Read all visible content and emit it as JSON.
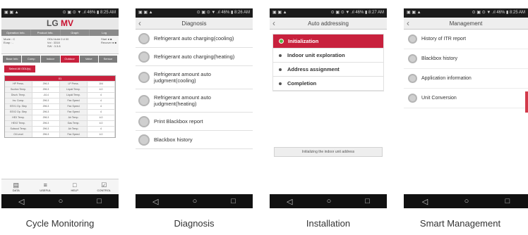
{
  "status_icons": "▣ ▣ ▲",
  "screens": {
    "cycle_monitoring": {
      "status_right": "⊙ ▣ ⊙ ▼ .ıl 46% ▮ 8:25 AM",
      "logo_prefix": "LG",
      "logo_suffix": "MV",
      "top_tabs": [
        "Operation Info.",
        "Product Info.",
        "Graph",
        "Log"
      ],
      "info_left": "Mode : C\nEvap : -",
      "info_mid": "ODU Addr 0 # 00\nVol : 3318\nSW : 3.3.8",
      "info_right": "Start ● ■\nRecover ● ■",
      "sub_tabs": [
        "Base Info",
        "Comp",
        "Indoor",
        "Outdoor",
        "Valve",
        "Sensor"
      ],
      "select_button": "Select All ODU(s)",
      "table_header": "01",
      "table_rows": [
        [
          "HP Press.",
          "296.3",
          "LP Press.",
          "104"
        ],
        [
          "Suction Temp.",
          "296.3",
          "Liquid Temp.",
          "4.0"
        ],
        [
          "Disch. Temp.",
          "-44.4",
          "Liquid Temp.",
          "4"
        ],
        [
          "Inv. Comp.",
          "296.3",
          "Fan Speed",
          "4"
        ],
        [
          "EEV1 Op. Step",
          "296.3",
          "Fan Speed",
          "4"
        ],
        [
          "EEV2 Op. Step",
          "296.3",
          "Fan Speed",
          "4"
        ],
        [
          "HEX Temp.",
          "296.3",
          "Air Temp.",
          "4.0"
        ],
        [
          "HEX2 Temp.",
          "296.3",
          "Gas Temp.",
          "4.0"
        ],
        [
          "Subcool Temp.",
          "296.3",
          "Air Temp.",
          "4"
        ],
        [
          "Oil Level",
          "296.3",
          "Fan Speed",
          "4.0"
        ]
      ],
      "bottom_tabs": [
        {
          "icon": "▤",
          "label": "DATA"
        },
        {
          "icon": "≡",
          "label": "USEFUL"
        },
        {
          "icon": "□",
          "label": "HELP"
        },
        {
          "icon": "☑",
          "label": "CONTROL"
        }
      ]
    },
    "diagnosis": {
      "status_right": "⊙ ▣ ⊙ ▼ .ıl 46% ▮ 8:26 AM",
      "title": "Diagnosis",
      "items": [
        "Refrigerant auto charging(cooling)",
        "Refrigerant auto charging(heating)",
        "Refrigerant amount auto judgment(cooling)",
        "Refrigerant amount auto judgment(heating)",
        "Print Blackbox report",
        "Blackbox history"
      ]
    },
    "auto_addressing": {
      "status_right": "⊙ ▣ ⊙ ▼ .ıl 46% ▮ 8:27 AM",
      "title": "Auto addressing",
      "items": [
        "Initialization",
        "Indoor unit exploration",
        "Address assignment",
        "Completion"
      ],
      "status_text": "Initializing the indoor unit address"
    },
    "management": {
      "status_right": "⊙ ▣ ⊙ ▼ .ıl 46% ▮ 8:25 AM",
      "title": "Management",
      "items": [
        "History of ITR report",
        "Blackbox history",
        "Application information",
        "Unit Conversion"
      ]
    }
  },
  "nav": {
    "back": "◁",
    "home": "○",
    "recent": "□"
  },
  "captions": [
    "Cycle Monitoring",
    "Diagnosis",
    "Installation",
    "Smart Management"
  ],
  "colors": {
    "accent": "#c8213d",
    "active_dot": "#57b947"
  }
}
